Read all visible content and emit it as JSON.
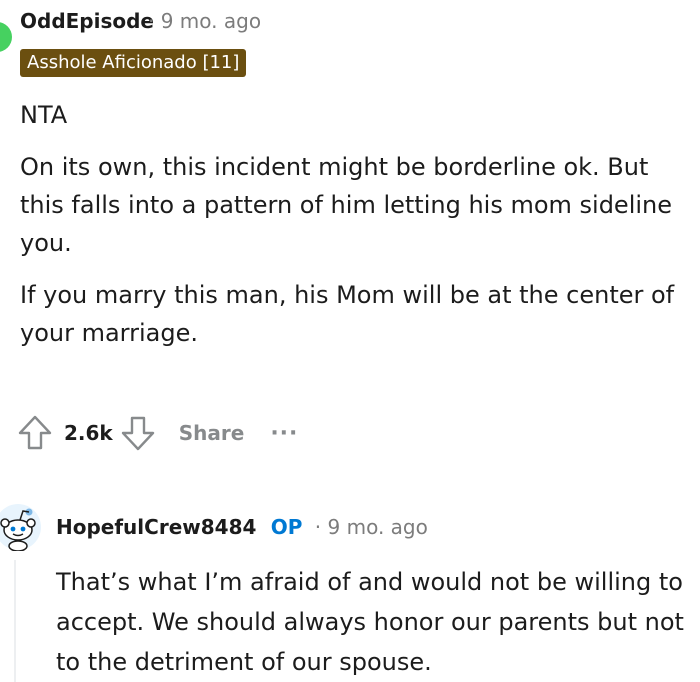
{
  "comment1": {
    "username": "OddEpisode",
    "timestamp": "· 9 mo. ago",
    "flair": "Asshole Aficionado [11]",
    "body": [
      "NTA",
      "On its own, this incident might be borderline ok. But this falls into a pattern of him letting his mom sideline you.",
      "If you marry this man, his Mom will be at the center of your marriage."
    ],
    "actions": {
      "upvote_icon": "upvote-arrow-icon",
      "score": "2.6k",
      "downvote_icon": "downvote-arrow-icon",
      "share_label": "Share",
      "more_label": "···"
    }
  },
  "comment2": {
    "username": "HopefulCrew8484",
    "op_badge": "OP",
    "timestamp": "· 9 mo. ago",
    "body": "That’s what I’m afraid of and would not be willing to accept. We should always honor our parents but not to the detriment of our spouse."
  },
  "colors": {
    "flair_bg": "#6b4f10",
    "op_blue": "#0079d3",
    "muted": "#878a8c",
    "avatar_green": "#46d160"
  }
}
